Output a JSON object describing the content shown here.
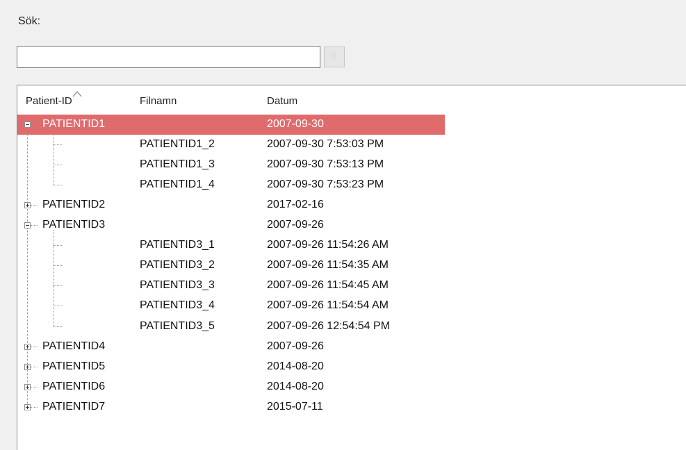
{
  "search": {
    "label": "Sök:",
    "value": "",
    "placeholder": ""
  },
  "columns": {
    "patient_id": "Patient-ID",
    "filename": "Filnamn",
    "date": "Datum"
  },
  "tree": [
    {
      "id": "PATIENTID1",
      "date": "2007-09-30",
      "expanded": true,
      "selected": true,
      "children": [
        {
          "file": "PATIENTID1_2",
          "date": "2007-09-30 7:53:03 PM"
        },
        {
          "file": "PATIENTID1_3",
          "date": "2007-09-30 7:53:13 PM"
        },
        {
          "file": "PATIENTID1_4",
          "date": "2007-09-30 7:53:23 PM"
        }
      ]
    },
    {
      "id": "PATIENTID2",
      "date": "2017-02-16",
      "expanded": false,
      "selected": false,
      "children": []
    },
    {
      "id": "PATIENTID3",
      "date": "2007-09-26",
      "expanded": true,
      "selected": false,
      "children": [
        {
          "file": "PATIENTID3_1",
          "date": "2007-09-26 11:54:26 AM"
        },
        {
          "file": "PATIENTID3_2",
          "date": "2007-09-26 11:54:35 AM"
        },
        {
          "file": "PATIENTID3_3",
          "date": "2007-09-26 11:54:45 AM"
        },
        {
          "file": "PATIENTID3_4",
          "date": "2007-09-26 11:54:54 AM"
        },
        {
          "file": "PATIENTID3_5",
          "date": "2007-09-26 12:54:54 PM"
        }
      ]
    },
    {
      "id": "PATIENTID4",
      "date": "2007-09-26",
      "expanded": false,
      "selected": false,
      "children": []
    },
    {
      "id": "PATIENTID5",
      "date": "2014-08-20",
      "expanded": false,
      "selected": false,
      "children": []
    },
    {
      "id": "PATIENTID6",
      "date": "2014-08-20",
      "expanded": false,
      "selected": false,
      "children": []
    },
    {
      "id": "PATIENTID7",
      "date": "2015-07-11",
      "expanded": false,
      "selected": false,
      "children": []
    }
  ],
  "colors": {
    "selection": "#e06b6d"
  },
  "icons": {
    "search_button": "search-icon",
    "sort": "sort-ascending-icon"
  }
}
